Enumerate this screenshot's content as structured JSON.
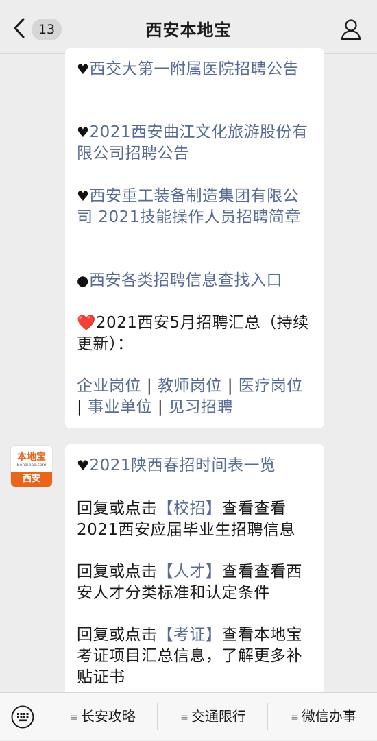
{
  "header": {
    "back_icon": "chevron-left-icon",
    "unread_count": "13",
    "title": "西安本地宝",
    "profile_icon": "person-icon"
  },
  "message1": {
    "items": [
      {
        "prefix": "♥",
        "text": "西交大第一附属医院招聘公告"
      },
      {
        "prefix": "♥",
        "text": "2021西安曲江文化旅游股份有限公司招聘公告"
      },
      {
        "prefix": "♥",
        "text": "西安重工装备制造集团有限公司 2021技能操作人员招聘简章"
      },
      {
        "prefix": "●",
        "text": "西安各类招聘信息查找入口"
      }
    ],
    "summary_heart": "❤️",
    "summary_text": "2021西安5月招聘汇总（持续更新）：",
    "links": {
      "l1": "企业岗位",
      "sep": "|",
      "l2": "教师岗位",
      "l3": "医疗岗位",
      "l4": "事业单位",
      "l5": "见习招聘"
    }
  },
  "avatar": {
    "logo_text": "本地宝",
    "logo_sub": "Bendibao.com",
    "logo_city": "西安"
  },
  "message2": {
    "item_prefix": "♥",
    "item_text": "2021陕西春招时间表一览",
    "reply1_pre": "回复或点击",
    "reply1_kw": "【校招】",
    "reply1_post": "查看查看2021西安应届毕业生招聘信息",
    "reply2_pre": "回复或点击",
    "reply2_kw": "【人才】",
    "reply2_post": "查看查看西安人才分类标准和认定条件",
    "reply3_pre": "回复或点击",
    "reply3_kw": "【考证】",
    "reply3_post": "查看本地宝考证项目汇总信息，了解更多补贴证书"
  },
  "menu": {
    "keyboard_icon": "keyboard-icon",
    "items": [
      "长安攻略",
      "交通限行",
      "微信办事"
    ]
  }
}
